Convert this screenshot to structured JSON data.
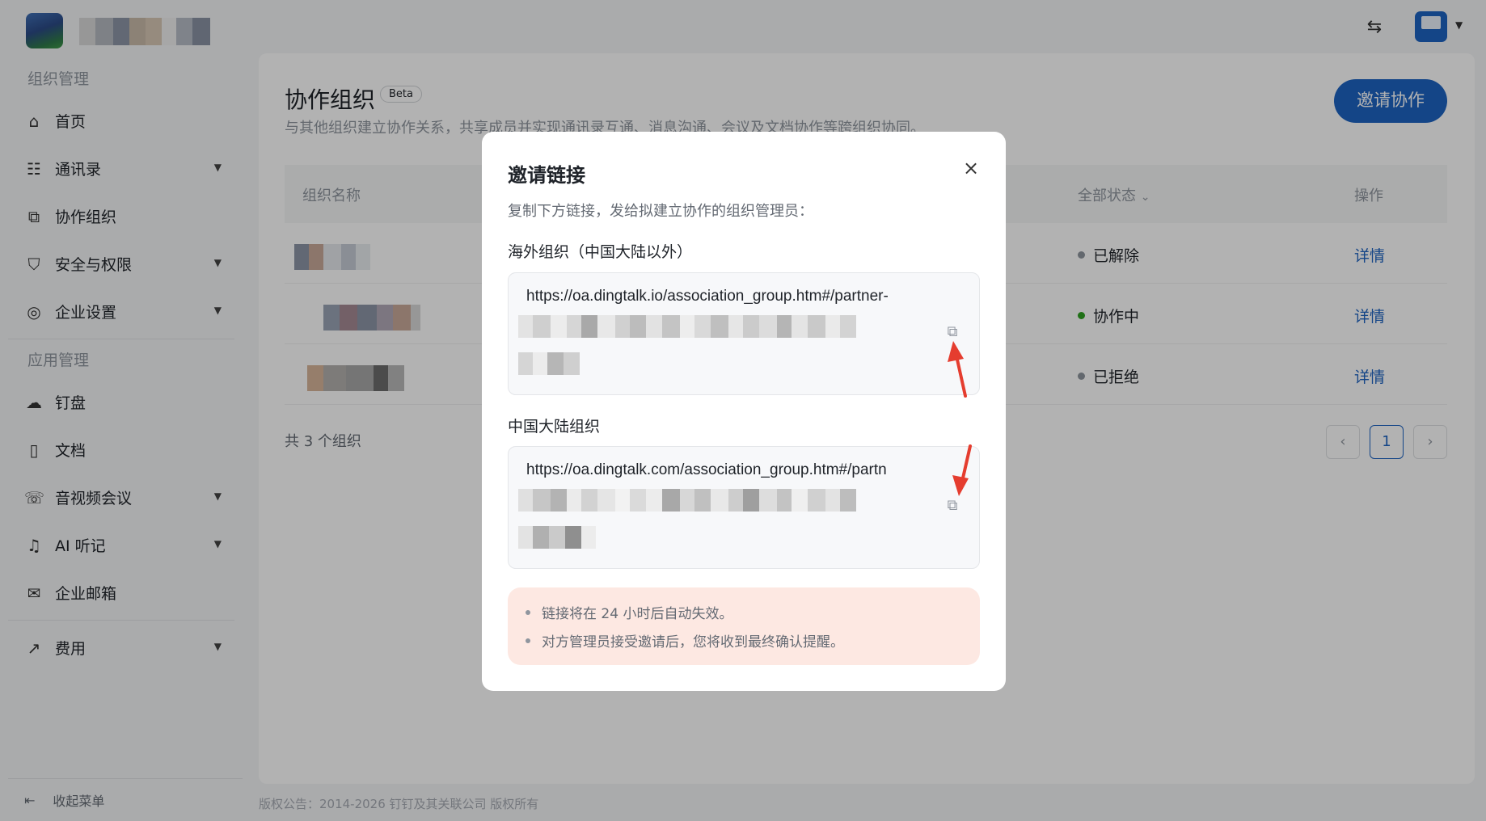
{
  "sidebar": {
    "section_org": "组织管理",
    "section_app": "应用管理",
    "items": [
      {
        "label": "首页",
        "icon": "home-icon",
        "glyph": "⌂",
        "caret": false
      },
      {
        "label": "通讯录",
        "icon": "contacts-icon",
        "glyph": "☷",
        "caret": true
      },
      {
        "label": "协作组织",
        "icon": "partner-org-icon",
        "glyph": "⧉",
        "caret": false
      },
      {
        "label": "安全与权限",
        "icon": "shield-icon",
        "glyph": "⛉",
        "caret": true
      },
      {
        "label": "企业设置",
        "icon": "settings-icon",
        "glyph": "◎",
        "caret": true
      },
      {
        "label": "钉盘",
        "icon": "cloud-drive-icon",
        "glyph": "☁",
        "caret": false
      },
      {
        "label": "文档",
        "icon": "document-icon",
        "glyph": "▯",
        "caret": false
      },
      {
        "label": "音视频会议",
        "icon": "phone-icon",
        "glyph": "☏",
        "caret": true
      },
      {
        "label": "AI 听记",
        "icon": "microphone-icon",
        "glyph": "♫",
        "caret": true
      },
      {
        "label": "企业邮箱",
        "icon": "mail-icon",
        "glyph": "✉",
        "caret": false
      },
      {
        "label": "费用",
        "icon": "chart-trend-icon",
        "glyph": "↗",
        "caret": true
      }
    ],
    "collapse_label": "收起菜单"
  },
  "page": {
    "title": "协作组织",
    "badge": "Beta",
    "description": "与其他组织建立协作关系，共享成员并实现通讯录互通、消息沟通、会议及文档协作等跨组织协同。",
    "invite_button": "邀请协作"
  },
  "table": {
    "headers": {
      "name": "组织名称",
      "status": "全部状态",
      "action": "操作"
    },
    "rows": [
      {
        "status": "已解除",
        "status_color": "#8f959e",
        "action": "详情"
      },
      {
        "status": "协作中",
        "status_color": "#2ea121",
        "action": "详情"
      },
      {
        "status": "已拒绝",
        "status_color": "#8f959e",
        "action": "详情"
      }
    ],
    "total": "共 3 个组织",
    "pagination": {
      "prev": "‹",
      "current": "1",
      "next": "›"
    }
  },
  "footer": "版权公告：2014-2026 钉钉及其关联公司 版权所有",
  "modal": {
    "title": "邀请链接",
    "close": "×",
    "description": "复制下方链接，发给拟建立协作的组织管理员：",
    "overseas_label": "海外组织（中国大陆以外）",
    "overseas_link": "https://oa.dingtalk.io/association_group.htm#/partner-",
    "mainland_label": "中国大陆组织",
    "mainland_link": "https://oa.dingtalk.com/association_group.htm#/partn",
    "copy_glyph": "⧉",
    "tips": [
      "链接将在 24 小时后自动失效。",
      "对方管理员接受邀请后，您将收到最终确认提醒。"
    ]
  },
  "colors": {
    "accent": "#1d63c2",
    "annotation_arrow": "#e53d2f",
    "tip_background": "#fde8e2"
  }
}
